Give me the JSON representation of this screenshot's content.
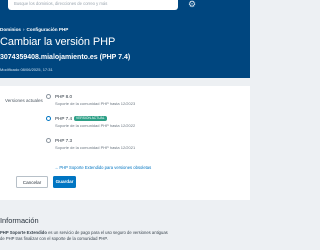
{
  "header": {
    "search_placeholder": "Busque los dominios, direcciones de correo y más",
    "breadcrumb": [
      "Dominios",
      "Configuración PHP"
    ],
    "title": "Cambiar la versión PHP",
    "domain": "3074359408.mialojamiento.es (PHP 7.4)",
    "subline": "Modificado 08/06/2025, 17:31"
  },
  "form": {
    "current_versions_label": "Versiones actuales",
    "options": [
      {
        "label": "PHP 8.0",
        "badge": "",
        "desc": "Soporte de la comunidad PHP hasta 12/2023",
        "selected": false
      },
      {
        "label": "PHP 7.4",
        "badge": "VERSIÓN ACTUAL",
        "desc": "Soporte de la comunidad PHP hasta 12/2022",
        "selected": true
      },
      {
        "label": "PHP 7.3",
        "badge": "",
        "desc": "Soporte de la comunidad PHP hasta 12/2021",
        "selected": false
      }
    ],
    "extended_support_link": "PHP Soporte Extendido para versiones obsoletas",
    "cancel_label": "Cancelar",
    "save_label": "Guardar"
  },
  "info": {
    "title": "Información",
    "bold_term": "PHP Soporte Extendido",
    "text": " es un servicio de pago para el uso seguro de versiones antiguas de PHP tras finalizar con el soporte de la comunidad PHP."
  },
  "colors": {
    "header_bg": "#00467f",
    "accent": "#0075c2",
    "badge_bg": "#2c9f86"
  }
}
